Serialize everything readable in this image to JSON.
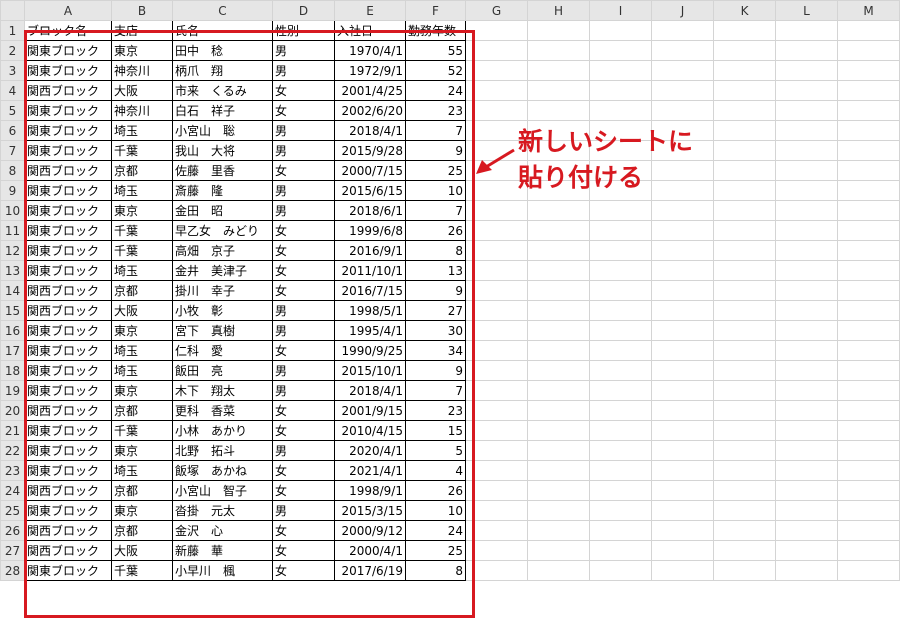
{
  "columns": [
    "A",
    "B",
    "C",
    "D",
    "E",
    "F",
    "G",
    "H",
    "I",
    "J",
    "K",
    "L",
    "M"
  ],
  "headers": [
    "ブロック名",
    "支店",
    "氏名",
    "性別",
    "入社日",
    "勤務年数"
  ],
  "rows": [
    [
      "関東ブロック",
      "東京",
      "田中　稔",
      "男",
      "1970/4/1",
      "55"
    ],
    [
      "関東ブロック",
      "神奈川",
      "柄爪　翔",
      "男",
      "1972/9/1",
      "52"
    ],
    [
      "関西ブロック",
      "大阪",
      "市来　くるみ",
      "女",
      "2001/4/25",
      "24"
    ],
    [
      "関東ブロック",
      "神奈川",
      "白石　祥子",
      "女",
      "2002/6/20",
      "23"
    ],
    [
      "関東ブロック",
      "埼玉",
      "小宮山　聡",
      "男",
      "2018/4/1",
      "7"
    ],
    [
      "関東ブロック",
      "千葉",
      "我山　大将",
      "男",
      "2015/9/28",
      "9"
    ],
    [
      "関西ブロック",
      "京都",
      "佐藤　里香",
      "女",
      "2000/7/15",
      "25"
    ],
    [
      "関東ブロック",
      "埼玉",
      "斎藤　隆",
      "男",
      "2015/6/15",
      "10"
    ],
    [
      "関東ブロック",
      "東京",
      "金田　昭",
      "男",
      "2018/6/1",
      "7"
    ],
    [
      "関東ブロック",
      "千葉",
      "早乙女　みどり",
      "女",
      "1999/6/8",
      "26"
    ],
    [
      "関東ブロック",
      "千葉",
      "高畑　京子",
      "女",
      "2016/9/1",
      "8"
    ],
    [
      "関東ブロック",
      "埼玉",
      "金井　美津子",
      "女",
      "2011/10/1",
      "13"
    ],
    [
      "関西ブロック",
      "京都",
      "掛川　幸子",
      "女",
      "2016/7/15",
      "9"
    ],
    [
      "関西ブロック",
      "大阪",
      "小牧　彰",
      "男",
      "1998/5/1",
      "27"
    ],
    [
      "関東ブロック",
      "東京",
      "宮下　真樹",
      "男",
      "1995/4/1",
      "30"
    ],
    [
      "関東ブロック",
      "埼玉",
      "仁科　愛",
      "女",
      "1990/9/25",
      "34"
    ],
    [
      "関東ブロック",
      "埼玉",
      "飯田　亮",
      "男",
      "2015/10/1",
      "9"
    ],
    [
      "関東ブロック",
      "東京",
      "木下　翔太",
      "男",
      "2018/4/1",
      "7"
    ],
    [
      "関西ブロック",
      "京都",
      "更科　香菜",
      "女",
      "2001/9/15",
      "23"
    ],
    [
      "関東ブロック",
      "千葉",
      "小林　あかり",
      "女",
      "2010/4/15",
      "15"
    ],
    [
      "関東ブロック",
      "東京",
      "北野　拓斗",
      "男",
      "2020/4/1",
      "5"
    ],
    [
      "関東ブロック",
      "埼玉",
      "飯塚　あかね",
      "女",
      "2021/4/1",
      "4"
    ],
    [
      "関西ブロック",
      "京都",
      "小宮山　智子",
      "女",
      "1998/9/1",
      "26"
    ],
    [
      "関東ブロック",
      "東京",
      "沓掛　元太",
      "男",
      "2015/3/15",
      "10"
    ],
    [
      "関西ブロック",
      "京都",
      "金沢　心",
      "女",
      "2000/9/12",
      "24"
    ],
    [
      "関西ブロック",
      "大阪",
      "新藤　華",
      "女",
      "2000/4/1",
      "25"
    ],
    [
      "関東ブロック",
      "千葉",
      "小早川　楓",
      "女",
      "2017/6/19",
      "8"
    ]
  ],
  "callout": {
    "line1": "新しいシートに",
    "line2": "貼り付ける"
  },
  "colors": {
    "highlight": "#d71920",
    "grid": "#d4d4d4",
    "header_bg": "#e6e6e6"
  }
}
